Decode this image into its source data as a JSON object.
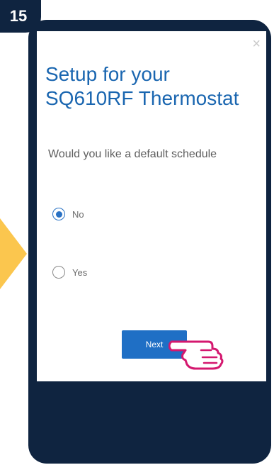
{
  "step": {
    "number": "15"
  },
  "dialog": {
    "close_glyph": "×",
    "title": "Setup for your SQ610RF Thermostat",
    "question": "Would you like a default schedule",
    "options": [
      {
        "label": "No",
        "selected": true
      },
      {
        "label": "Yes",
        "selected": false
      }
    ],
    "next_label": "Next"
  },
  "colors": {
    "phone_frame": "#0f2440",
    "accent_blue": "#1f6fc5",
    "title_blue": "#1a66b0",
    "arrow_yellow": "#fbc64e",
    "hand_pink": "#d4186f"
  },
  "icons": [
    "close-icon",
    "radio-selected-icon",
    "radio-unselected-icon",
    "pointing-hand-icon",
    "arrow-icon"
  ]
}
